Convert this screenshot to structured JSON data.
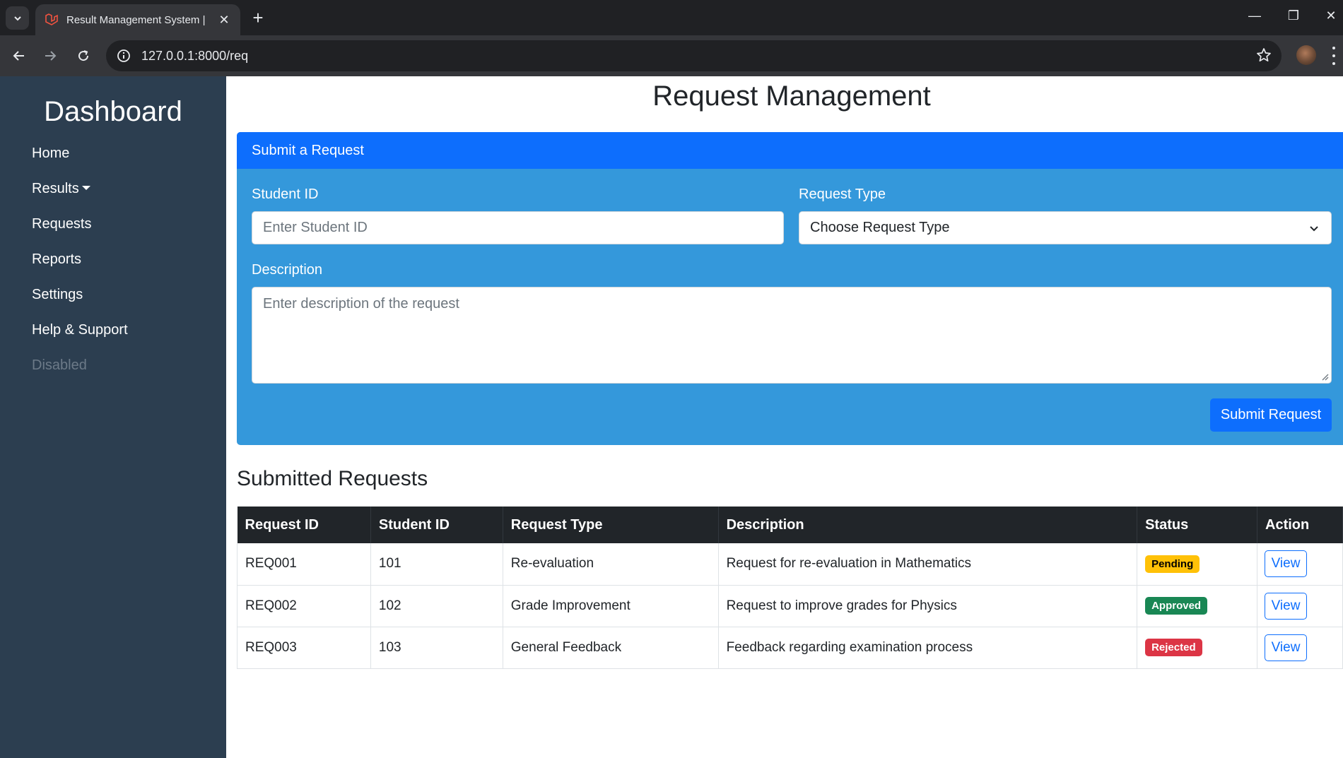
{
  "browser": {
    "tab_title": "Result Management System |",
    "url": "127.0.0.1:8000/req"
  },
  "sidebar": {
    "title": "Dashboard",
    "items": [
      {
        "label": "Home"
      },
      {
        "label": "Results"
      },
      {
        "label": "Requests"
      },
      {
        "label": "Reports"
      },
      {
        "label": "Settings"
      },
      {
        "label": "Help & Support"
      },
      {
        "label": "Disabled"
      }
    ]
  },
  "page": {
    "title": "Request Management"
  },
  "form": {
    "header": "Submit a Request",
    "student_id_label": "Student ID",
    "student_id_placeholder": "Enter Student ID",
    "request_type_label": "Request Type",
    "request_type_value": "Choose Request Type",
    "description_label": "Description",
    "description_placeholder": "Enter description of the request",
    "submit_label": "Submit Request"
  },
  "requests": {
    "title": "Submitted Requests",
    "columns": [
      "Request ID",
      "Student ID",
      "Request Type",
      "Description",
      "Status",
      "Action"
    ],
    "rows": [
      {
        "id": "REQ001",
        "student": "101",
        "type": "Re-evaluation",
        "description": "Request for re-evaluation in Mathematics",
        "status": "Pending",
        "action": "View"
      },
      {
        "id": "REQ002",
        "student": "102",
        "type": "Grade Improvement",
        "description": "Request to improve grades for Physics",
        "status": "Approved",
        "action": "View"
      },
      {
        "id": "REQ003",
        "student": "103",
        "type": "General Feedback",
        "description": "Feedback regarding examination process",
        "status": "Rejected",
        "action": "View"
      }
    ]
  },
  "colors": {
    "sidebar_bg": "#2c3e50",
    "card_bg": "#3498db",
    "primary": "#0d6efd",
    "table_header": "#212529",
    "pending": "#ffc107",
    "approved": "#198754",
    "rejected": "#dc3545"
  }
}
